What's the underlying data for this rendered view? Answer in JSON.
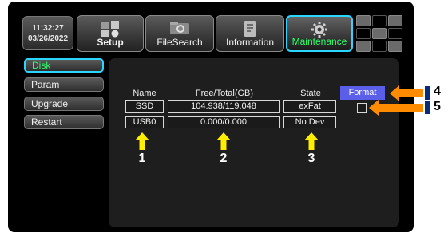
{
  "clock": {
    "time": "11:32:27",
    "date": "03/26/2022"
  },
  "tabs": [
    {
      "label": "Setup",
      "icon": "setup-grid-icon"
    },
    {
      "label": "FileSearch",
      "icon": "folder-search-icon"
    },
    {
      "label": "Information",
      "icon": "document-icon"
    },
    {
      "label": "Maintenance",
      "icon": "gear-icon"
    }
  ],
  "sidebar": {
    "items": [
      {
        "label": "Disk"
      },
      {
        "label": "Param"
      },
      {
        "label": "Upgrade"
      },
      {
        "label": "Restart"
      }
    ]
  },
  "table": {
    "headers": {
      "name": "Name",
      "free_total": "Free/Total(GB)",
      "state": "State"
    },
    "rows": [
      {
        "name": "SSD",
        "free_total": "104.938/119.048",
        "state": "exFat"
      },
      {
        "name": "USB0",
        "free_total": "0.000/0.000",
        "state": "No Dev"
      }
    ]
  },
  "format_button": {
    "label": "Format"
  },
  "callouts": {
    "c1": "1",
    "c2": "2",
    "c3": "3",
    "c4": "4",
    "c5": "5"
  },
  "colors": {
    "active_border": "#2ad6ff",
    "active_text": "#2aff6a",
    "format_button": "#5a5ee8",
    "yellow_arrow": "#ffee00",
    "orange_arrow": "#ff8c00",
    "navy_marker": "#0a2a7a"
  }
}
